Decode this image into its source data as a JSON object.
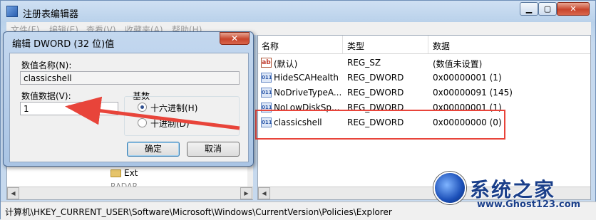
{
  "window": {
    "title": "注册表编辑器",
    "min_glyph": "▁",
    "max_glyph": "▢",
    "close_glyph": "✕"
  },
  "menubar": {
    "items": [
      "文件(F)",
      "编辑(E)",
      "查看(V)",
      "收藏夹(A)",
      "帮助(H)"
    ]
  },
  "tree": {
    "visible_item": "Ext",
    "partial_item": "RADAR"
  },
  "list": {
    "columns": [
      "名称",
      "类型",
      "数据"
    ],
    "rows": [
      {
        "icon": "string-value-icon",
        "name": "(默认)",
        "type": "REG_SZ",
        "data": "(数值未设置)"
      },
      {
        "icon": "dword-value-icon",
        "name": "HideSCAHealth",
        "type": "REG_DWORD",
        "data": "0x00000001 (1)"
      },
      {
        "icon": "dword-value-icon",
        "name": "NoDriveTypeA...",
        "type": "REG_DWORD",
        "data": "0x00000091 (145)"
      },
      {
        "icon": "dword-value-icon",
        "name": "NoLowDiskSp...",
        "type": "REG_DWORD",
        "data": "0x00000001 (1)"
      },
      {
        "icon": "dword-value-icon",
        "name": "classicshell",
        "type": "REG_DWORD",
        "data": "0x00000000 (0)"
      }
    ],
    "highlight_color": "#e8443a"
  },
  "statusbar": {
    "path": "计算机\\HKEY_CURRENT_USER\\Software\\Microsoft\\Windows\\CurrentVersion\\Policies\\Explorer"
  },
  "dialog": {
    "title": "编辑 DWORD (32 位)值",
    "close_glyph": "✕",
    "name_label": "数值名称(N):",
    "name_value": "classicshell",
    "data_label": "数值数据(V):",
    "data_value": "1",
    "base_label": "基数",
    "hex_label": "十六进制(H)",
    "dec_label": "十进制(D)",
    "selected_base": "hex",
    "ok_label": "确定",
    "cancel_label": "取消"
  },
  "watermark": {
    "title": "系统之家",
    "url": "www.Ghost123.com"
  },
  "annotation": {
    "arrow_color": "#e8443a"
  }
}
